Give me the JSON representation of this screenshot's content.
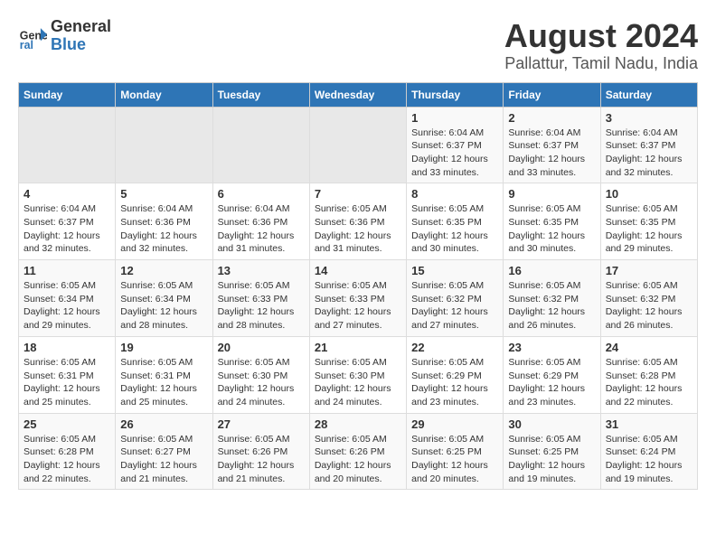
{
  "header": {
    "logo_line1": "General",
    "logo_line2": "Blue",
    "title": "August 2024",
    "subtitle": "Pallattur, Tamil Nadu, India"
  },
  "days_of_week": [
    "Sunday",
    "Monday",
    "Tuesday",
    "Wednesday",
    "Thursday",
    "Friday",
    "Saturday"
  ],
  "weeks": [
    [
      {
        "num": "",
        "empty": true
      },
      {
        "num": "",
        "empty": true
      },
      {
        "num": "",
        "empty": true
      },
      {
        "num": "",
        "empty": true
      },
      {
        "num": "1",
        "sunrise": "6:04 AM",
        "sunset": "6:37 PM",
        "daylight": "12 hours and 33 minutes."
      },
      {
        "num": "2",
        "sunrise": "6:04 AM",
        "sunset": "6:37 PM",
        "daylight": "12 hours and 33 minutes."
      },
      {
        "num": "3",
        "sunrise": "6:04 AM",
        "sunset": "6:37 PM",
        "daylight": "12 hours and 32 minutes."
      }
    ],
    [
      {
        "num": "4",
        "sunrise": "6:04 AM",
        "sunset": "6:37 PM",
        "daylight": "12 hours and 32 minutes."
      },
      {
        "num": "5",
        "sunrise": "6:04 AM",
        "sunset": "6:36 PM",
        "daylight": "12 hours and 32 minutes."
      },
      {
        "num": "6",
        "sunrise": "6:04 AM",
        "sunset": "6:36 PM",
        "daylight": "12 hours and 31 minutes."
      },
      {
        "num": "7",
        "sunrise": "6:05 AM",
        "sunset": "6:36 PM",
        "daylight": "12 hours and 31 minutes."
      },
      {
        "num": "8",
        "sunrise": "6:05 AM",
        "sunset": "6:35 PM",
        "daylight": "12 hours and 30 minutes."
      },
      {
        "num": "9",
        "sunrise": "6:05 AM",
        "sunset": "6:35 PM",
        "daylight": "12 hours and 30 minutes."
      },
      {
        "num": "10",
        "sunrise": "6:05 AM",
        "sunset": "6:35 PM",
        "daylight": "12 hours and 29 minutes."
      }
    ],
    [
      {
        "num": "11",
        "sunrise": "6:05 AM",
        "sunset": "6:34 PM",
        "daylight": "12 hours and 29 minutes."
      },
      {
        "num": "12",
        "sunrise": "6:05 AM",
        "sunset": "6:34 PM",
        "daylight": "12 hours and 28 minutes."
      },
      {
        "num": "13",
        "sunrise": "6:05 AM",
        "sunset": "6:33 PM",
        "daylight": "12 hours and 28 minutes."
      },
      {
        "num": "14",
        "sunrise": "6:05 AM",
        "sunset": "6:33 PM",
        "daylight": "12 hours and 27 minutes."
      },
      {
        "num": "15",
        "sunrise": "6:05 AM",
        "sunset": "6:32 PM",
        "daylight": "12 hours and 27 minutes."
      },
      {
        "num": "16",
        "sunrise": "6:05 AM",
        "sunset": "6:32 PM",
        "daylight": "12 hours and 26 minutes."
      },
      {
        "num": "17",
        "sunrise": "6:05 AM",
        "sunset": "6:32 PM",
        "daylight": "12 hours and 26 minutes."
      }
    ],
    [
      {
        "num": "18",
        "sunrise": "6:05 AM",
        "sunset": "6:31 PM",
        "daylight": "12 hours and 25 minutes."
      },
      {
        "num": "19",
        "sunrise": "6:05 AM",
        "sunset": "6:31 PM",
        "daylight": "12 hours and 25 minutes."
      },
      {
        "num": "20",
        "sunrise": "6:05 AM",
        "sunset": "6:30 PM",
        "daylight": "12 hours and 24 minutes."
      },
      {
        "num": "21",
        "sunrise": "6:05 AM",
        "sunset": "6:30 PM",
        "daylight": "12 hours and 24 minutes."
      },
      {
        "num": "22",
        "sunrise": "6:05 AM",
        "sunset": "6:29 PM",
        "daylight": "12 hours and 23 minutes."
      },
      {
        "num": "23",
        "sunrise": "6:05 AM",
        "sunset": "6:29 PM",
        "daylight": "12 hours and 23 minutes."
      },
      {
        "num": "24",
        "sunrise": "6:05 AM",
        "sunset": "6:28 PM",
        "daylight": "12 hours and 22 minutes."
      }
    ],
    [
      {
        "num": "25",
        "sunrise": "6:05 AM",
        "sunset": "6:28 PM",
        "daylight": "12 hours and 22 minutes."
      },
      {
        "num": "26",
        "sunrise": "6:05 AM",
        "sunset": "6:27 PM",
        "daylight": "12 hours and 21 minutes."
      },
      {
        "num": "27",
        "sunrise": "6:05 AM",
        "sunset": "6:26 PM",
        "daylight": "12 hours and 21 minutes."
      },
      {
        "num": "28",
        "sunrise": "6:05 AM",
        "sunset": "6:26 PM",
        "daylight": "12 hours and 20 minutes."
      },
      {
        "num": "29",
        "sunrise": "6:05 AM",
        "sunset": "6:25 PM",
        "daylight": "12 hours and 20 minutes."
      },
      {
        "num": "30",
        "sunrise": "6:05 AM",
        "sunset": "6:25 PM",
        "daylight": "12 hours and 19 minutes."
      },
      {
        "num": "31",
        "sunrise": "6:05 AM",
        "sunset": "6:24 PM",
        "daylight": "12 hours and 19 minutes."
      }
    ]
  ],
  "labels": {
    "sunrise": "Sunrise:",
    "sunset": "Sunset:",
    "daylight": "Daylight:"
  }
}
